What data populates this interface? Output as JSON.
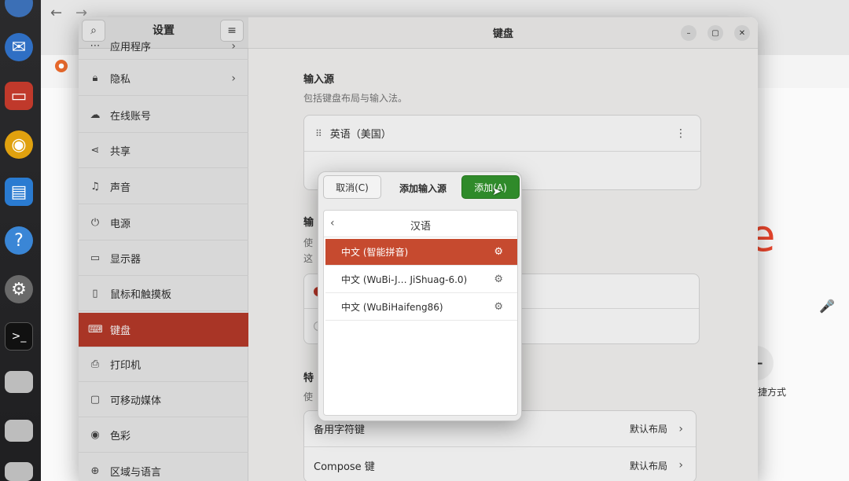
{
  "colors": {
    "accent_selected": "#b83a2a",
    "dialog_selected": "#c64a2f",
    "add_button": "#2f8a2a"
  },
  "dock": {
    "icons": [
      "chromium-icon",
      "thunderbird-icon",
      "files-icon",
      "rhythmbox-icon",
      "writer-icon",
      "help-icon",
      "settings-icon",
      "terminal-icon",
      "drive-icon",
      "drive-icon",
      "drive-icon"
    ]
  },
  "browser": {
    "logo_fragment": "e",
    "shortcut_label": "快捷方式"
  },
  "settings": {
    "sidebar_title": "设置",
    "sidebar": [
      {
        "label": "应用程序",
        "icon": "apps-icon"
      },
      {
        "label": "隐私",
        "icon": "lock-icon"
      },
      {
        "label": "在线账号",
        "icon": "cloud-icon"
      },
      {
        "label": "共享",
        "icon": "share-icon"
      },
      {
        "label": "声音",
        "icon": "music-icon"
      },
      {
        "label": "电源",
        "icon": "power-icon"
      },
      {
        "label": "显示器",
        "icon": "display-icon"
      },
      {
        "label": "鼠标和触摸板",
        "icon": "mouse-icon"
      },
      {
        "label": "键盘",
        "icon": "keyboard-icon"
      },
      {
        "label": "打印机",
        "icon": "printer-icon"
      },
      {
        "label": "可移动媒体",
        "icon": "media-icon"
      },
      {
        "label": "色彩",
        "icon": "color-icon"
      },
      {
        "label": "区域与语言",
        "icon": "globe-icon"
      }
    ],
    "main_title": "键盘",
    "input_sources": {
      "title": "输入源",
      "description": "包括键盘布局与输入法。",
      "items": [
        "英语（美国）"
      ]
    },
    "section2": {
      "title_fragment": "输",
      "desc_fragment_1": "使",
      "desc_fragment_2": "这"
    },
    "section3": {
      "title_fragment": "特",
      "desc_fragment": "使"
    },
    "rows": [
      {
        "label": "备用字符键",
        "value": "默认布局"
      },
      {
        "label": "Compose 键",
        "value": "默认布局"
      }
    ]
  },
  "dialog": {
    "cancel_label": "取消(C)",
    "title": "添加输入源",
    "add_label": "添加(A)",
    "language": "汉语",
    "sources": [
      {
        "label": "中文 (智能拼音)",
        "selected": true
      },
      {
        "label": "中文 (WuBi-J… JiShuag-6.0)",
        "selected": false
      },
      {
        "label": "中文 (WuBiHaifeng86)",
        "selected": false
      }
    ]
  }
}
